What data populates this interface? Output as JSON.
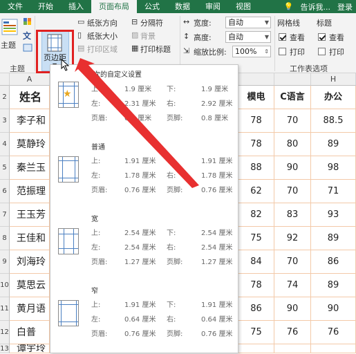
{
  "tabs": [
    "文件",
    "开始",
    "插入",
    "页面布局",
    "公式",
    "数据",
    "审阅",
    "视图"
  ],
  "tell_me": "告诉我...",
  "login": "登录",
  "ribbon": {
    "theme_label": "主题",
    "theme_group": "主题",
    "margins_label": "页边距",
    "orientation": "纸张方向",
    "size": "纸张大小",
    "print_area": "打印区域",
    "breaks": "分隔符",
    "background": "背景",
    "print_titles": "打印标题",
    "width_label": "宽度:",
    "height_label": "高度:",
    "scale_label": "缩放比例:",
    "width_value": "自动",
    "height_value": "自动",
    "scale_value": "100%",
    "gridlines": "网格线",
    "headings": "标题",
    "view1": "查看",
    "print1": "打印",
    "view2": "查看",
    "print2": "打印",
    "sheet_options_group": "工作表选项"
  },
  "columns": [
    "A",
    "H"
  ],
  "rows": [
    "2",
    "3",
    "4",
    "5",
    "6",
    "7",
    "8",
    "9",
    "10",
    "11",
    "12",
    "13"
  ],
  "left_cells": [
    "姓名",
    "李子和",
    "莫静玲",
    "秦兰玉",
    "范振理",
    "王玉芳",
    "王佳和",
    "刘海玲",
    "莫思云",
    "黄月语",
    "白普",
    "谭宇玲"
  ],
  "right_headers": [
    "模电",
    "C语言",
    "办公"
  ],
  "right_rows": [
    [
      "78",
      "70",
      "88.5"
    ],
    [
      "78",
      "80",
      "89"
    ],
    [
      "88",
      "90",
      "98"
    ],
    [
      "62",
      "70",
      "71"
    ],
    [
      "82",
      "83",
      "93"
    ],
    [
      "75",
      "92",
      "89"
    ],
    [
      "84",
      "70",
      "86"
    ],
    [
      "78",
      "74",
      "89"
    ],
    [
      "86",
      "90",
      "90"
    ],
    [
      "75",
      "76",
      "76"
    ],
    [
      "",
      "",
      ""
    ]
  ],
  "margin_options": [
    {
      "title": "上次的自定义设置",
      "r1": [
        "上:",
        "1.9 厘米",
        "下:",
        "1.9 厘米"
      ],
      "r2": [
        "左:",
        "2.31 厘米",
        "右:",
        "2.92 厘米"
      ],
      "r3": [
        "页眉:",
        "0.8 厘米",
        "页脚:",
        "0.8 厘米"
      ]
    },
    {
      "title": "普通",
      "r1": [
        "上:",
        "1.91 厘米",
        "下:",
        "1.91 厘米"
      ],
      "r2": [
        "左:",
        "1.78 厘米",
        "右:",
        "1.78 厘米"
      ],
      "r3": [
        "页眉:",
        "0.76 厘米",
        "页脚:",
        "0.76 厘米"
      ]
    },
    {
      "title": "宽",
      "r1": [
        "上:",
        "2.54 厘米",
        "下:",
        "2.54 厘米"
      ],
      "r2": [
        "左:",
        "2.54 厘米",
        "右:",
        "2.54 厘米"
      ],
      "r3": [
        "页眉:",
        "1.27 厘米",
        "页脚:",
        "1.27 厘米"
      ]
    },
    {
      "title": "窄",
      "r1": [
        "上:",
        "1.91 厘米",
        "下:",
        "1.91 厘米"
      ],
      "r2": [
        "左:",
        "0.64 厘米",
        "右:",
        "0.64 厘米"
      ],
      "r3": [
        "页眉:",
        "0.76 厘米",
        "页脚:",
        "0.76 厘米"
      ]
    }
  ],
  "colors": {
    "excel_green": "#217346",
    "highlight_red": "#e02020",
    "grid_orange": "#f3c9a8"
  }
}
